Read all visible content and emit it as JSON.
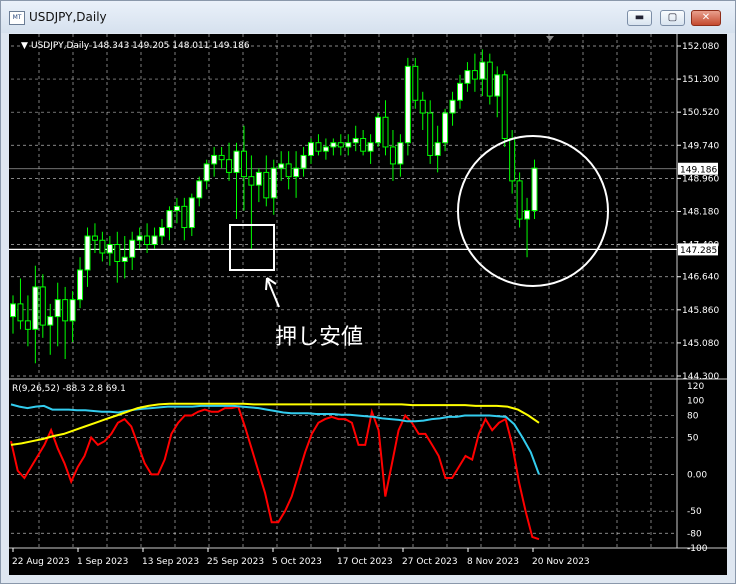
{
  "window": {
    "title": "USDJPY,Daily",
    "minimize_glyph": "▬",
    "maximize_glyph": "▢",
    "close_glyph": "✕"
  },
  "chart": {
    "header": "USDJPY,Daily  148.343 149.205 148.011 149.186",
    "price_labels": [
      "152.080",
      "151.300",
      "150.520",
      "149.740",
      "148.960",
      "148.180",
      "147.400",
      "146.640",
      "145.860",
      "145.080",
      "144.300"
    ],
    "current_price": "149.186",
    "hline_price": "147.285",
    "annotation": "押し安値",
    "indicator_header": "R(9,26,52) -88.3 2.8 69.1",
    "indicator_labels": [
      "120",
      "100",
      "80",
      "50",
      "0.00",
      "-50",
      "-80",
      "-100"
    ],
    "dates": [
      "22 Aug 2023",
      "1 Sep 2023",
      "13 Sep 2023",
      "25 Sep 2023",
      "5 Oct 2023",
      "17 Oct 2023",
      "27 Oct 2023",
      "8 Nov 2023",
      "20 Nov 2023"
    ],
    "colors": {
      "bull": "#00ff00",
      "bull_body": "#ffffff",
      "bear": "#00ff00",
      "bear_body": "#000000",
      "grid": "#ffffff",
      "red": "#ff0000",
      "cyan": "#33ccee",
      "yellow": "#ffff00"
    }
  },
  "chart_data": {
    "type": "candlestick",
    "series": [
      {
        "name": "USDJPY,Daily",
        "values": [
          [
            145.7,
            146.2,
            145.3,
            146.0
          ],
          [
            146.0,
            146.6,
            145.4,
            145.6
          ],
          [
            145.6,
            146.2,
            145.0,
            145.4
          ],
          [
            145.4,
            146.9,
            144.6,
            146.4
          ],
          [
            146.4,
            146.7,
            145.2,
            145.5
          ],
          [
            145.5,
            146.0,
            144.8,
            145.7
          ],
          [
            145.7,
            146.5,
            145.0,
            146.1
          ],
          [
            146.1,
            146.4,
            144.7,
            145.6
          ],
          [
            145.6,
            146.3,
            145.1,
            146.1
          ],
          [
            146.1,
            147.1,
            145.9,
            146.8
          ],
          [
            146.8,
            147.8,
            146.4,
            147.6
          ],
          [
            147.6,
            147.9,
            147.2,
            147.5
          ],
          [
            147.5,
            147.7,
            147.0,
            147.2
          ],
          [
            147.2,
            147.6,
            146.9,
            147.4
          ],
          [
            147.4,
            147.7,
            146.5,
            147.0
          ],
          [
            147.0,
            147.6,
            146.6,
            147.1
          ],
          [
            147.1,
            147.7,
            146.8,
            147.5
          ],
          [
            147.5,
            147.8,
            147.3,
            147.6
          ],
          [
            147.6,
            147.9,
            147.2,
            147.4
          ],
          [
            147.4,
            147.8,
            147.3,
            147.6
          ],
          [
            147.6,
            148.0,
            147.4,
            147.8
          ],
          [
            147.8,
            148.3,
            147.5,
            148.2
          ],
          [
            148.2,
            148.5,
            147.9,
            148.3
          ],
          [
            148.3,
            148.5,
            147.5,
            147.8
          ],
          [
            147.8,
            148.6,
            147.6,
            148.5
          ],
          [
            148.5,
            149.0,
            148.3,
            148.9
          ],
          [
            148.9,
            149.4,
            148.7,
            149.3
          ],
          [
            149.3,
            149.7,
            149.0,
            149.5
          ],
          [
            149.5,
            149.7,
            149.2,
            149.4
          ],
          [
            149.4,
            149.8,
            148.9,
            149.1
          ],
          [
            149.1,
            149.8,
            148.0,
            149.6
          ],
          [
            149.6,
            150.2,
            148.2,
            149.0
          ],
          [
            149.0,
            149.5,
            147.3,
            148.8
          ],
          [
            148.8,
            149.2,
            148.4,
            149.1
          ],
          [
            149.1,
            149.5,
            148.3,
            148.5
          ],
          [
            148.5,
            149.4,
            148.1,
            149.2
          ],
          [
            149.2,
            149.6,
            148.9,
            149.3
          ],
          [
            149.3,
            149.6,
            148.7,
            149.0
          ],
          [
            149.0,
            149.6,
            148.5,
            149.2
          ],
          [
            149.2,
            149.7,
            149.0,
            149.5
          ],
          [
            149.5,
            149.9,
            149.3,
            149.8
          ],
          [
            149.8,
            150.0,
            149.5,
            149.6
          ],
          [
            149.6,
            149.9,
            149.4,
            149.7
          ],
          [
            149.7,
            149.9,
            149.5,
            149.8
          ],
          [
            149.8,
            150.0,
            149.5,
            149.7
          ],
          [
            149.7,
            150.0,
            149.5,
            149.8
          ],
          [
            149.8,
            150.2,
            149.6,
            149.9
          ],
          [
            149.9,
            150.1,
            149.5,
            149.6
          ],
          [
            149.6,
            150.0,
            149.3,
            149.8
          ],
          [
            149.8,
            150.5,
            149.7,
            150.4
          ],
          [
            150.4,
            150.8,
            149.5,
            149.7
          ],
          [
            149.7,
            150.1,
            148.9,
            149.3
          ],
          [
            149.3,
            150.0,
            149.0,
            149.8
          ],
          [
            149.8,
            151.8,
            149.5,
            151.6
          ],
          [
            151.6,
            151.8,
            150.6,
            150.8
          ],
          [
            150.8,
            151.0,
            150.1,
            150.5
          ],
          [
            150.5,
            150.8,
            149.3,
            149.5
          ],
          [
            149.5,
            150.2,
            149.1,
            149.8
          ],
          [
            149.8,
            150.6,
            149.6,
            150.5
          ],
          [
            150.5,
            151.0,
            150.2,
            150.8
          ],
          [
            150.8,
            151.4,
            150.6,
            151.2
          ],
          [
            151.2,
            151.7,
            151.0,
            151.5
          ],
          [
            151.5,
            151.9,
            151.0,
            151.3
          ],
          [
            151.3,
            152.0,
            150.9,
            151.7
          ],
          [
            151.7,
            151.9,
            150.7,
            150.9
          ],
          [
            150.9,
            151.6,
            150.4,
            151.4
          ],
          [
            151.4,
            151.5,
            149.7,
            149.9
          ],
          [
            149.9,
            150.1,
            148.6,
            148.9
          ],
          [
            148.9,
            149.1,
            147.8,
            148.0
          ],
          [
            148.0,
            148.5,
            147.1,
            148.2
          ],
          [
            148.2,
            149.4,
            148.0,
            149.2
          ]
        ]
      }
    ],
    "price_ylim": [
      144.3,
      152.08
    ],
    "current_price": 149.186,
    "hline": 147.285,
    "x": [
      "22 Aug 2023",
      "1 Sep 2023",
      "13 Sep 2023",
      "25 Sep 2023",
      "5 Oct 2023",
      "17 Oct 2023",
      "27 Oct 2023",
      "8 Nov 2023",
      "20 Nov 2023"
    ],
    "indicator": {
      "ylim": [
        -100,
        120
      ],
      "levels": [
        80,
        0,
        -80
      ],
      "lines": [
        {
          "color": "#ff0000",
          "values": [
            45,
            5,
            -5,
            10,
            25,
            40,
            60,
            35,
            15,
            -10,
            10,
            25,
            50,
            40,
            45,
            55,
            70,
            75,
            65,
            40,
            15,
            0,
            0,
            20,
            55,
            70,
            80,
            80,
            85,
            88,
            85,
            85,
            90,
            90,
            92,
            65,
            35,
            5,
            -25,
            -65,
            -65,
            -50,
            -30,
            0,
            30,
            55,
            70,
            75,
            78,
            75,
            75,
            70,
            40,
            40,
            85,
            60,
            -30,
            15,
            60,
            80,
            70,
            55,
            55,
            40,
            25,
            -5,
            -5,
            10,
            25,
            20,
            55,
            75,
            60,
            70,
            75,
            40,
            -10,
            -50,
            -85,
            -88
          ]
        },
        {
          "color": "#33ccee",
          "values": [
            95,
            92,
            90,
            92,
            93,
            88,
            88,
            88,
            87,
            87,
            86,
            85,
            85,
            84,
            86,
            88,
            89,
            90,
            91,
            92,
            92,
            92,
            92,
            93,
            93,
            93,
            93,
            93,
            92,
            91,
            90,
            88,
            86,
            84,
            83,
            83,
            83,
            82,
            82,
            82,
            81,
            81,
            80,
            79,
            78,
            76,
            75,
            74,
            72,
            72,
            73,
            75,
            76,
            78,
            78,
            80,
            80,
            80,
            80,
            79,
            78,
            68,
            50,
            30,
            0
          ]
        },
        {
          "color": "#ffff00",
          "values": [
            40,
            42,
            45,
            48,
            52,
            55,
            60,
            65,
            70,
            75,
            80,
            85,
            90,
            93,
            95,
            96,
            96,
            96,
            96,
            96,
            96,
            96,
            96,
            95,
            95,
            95,
            95,
            95,
            95,
            95,
            95,
            95,
            95,
            95,
            95,
            95,
            95,
            95,
            94,
            94,
            94,
            94,
            94,
            94,
            93,
            93,
            93,
            92,
            88,
            80,
            70
          ]
        }
      ]
    }
  }
}
